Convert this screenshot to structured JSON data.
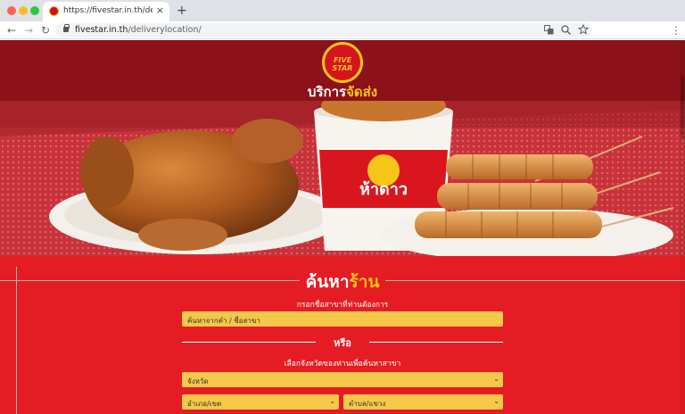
{
  "browser": {
    "tab_title": "https://fivestar.in.th/deliverylo",
    "tab_close": "×",
    "new_tab": "+",
    "url_host": "fivestar.in.th",
    "url_path": "/deliverylocation/",
    "back": "←",
    "forward": "→",
    "reload": "↻",
    "menu": "⋮",
    "icons": [
      "translate-icon",
      "zoom-icon",
      "star-icon"
    ],
    "dots": [
      "#ff5f57",
      "#febc2e",
      "#28c840"
    ]
  },
  "header": {
    "logo_text": "FIVE STAR",
    "service_title_part1": "บริการ",
    "service_title_part2": "จัดส่ง"
  },
  "hero": {
    "bucket_brand": "ห้าดาว"
  },
  "form": {
    "title_part1": "ค้นหา",
    "title_part2": "ร้าน",
    "branch_prompt": "กรอกชื่อสาขาที่ท่านต้องการ",
    "search_placeholder": "ค้นหาจากคำ / ชื่อสาขา",
    "or_text": "หรือ",
    "province_prompt": "เลือกจังหวัดของท่านเพื่อค้นหาสาขา",
    "province_select": "จังหวัด",
    "district_select": "อำเภอ/เขต",
    "subdistrict_select": "ตำบล/แขวง",
    "chevron": "⌄"
  },
  "colors": {
    "header_bg": "#8c1119",
    "form_bg": "#e51c23",
    "field_bg": "#f5c84b",
    "accent_yellow": "#f5c518"
  }
}
